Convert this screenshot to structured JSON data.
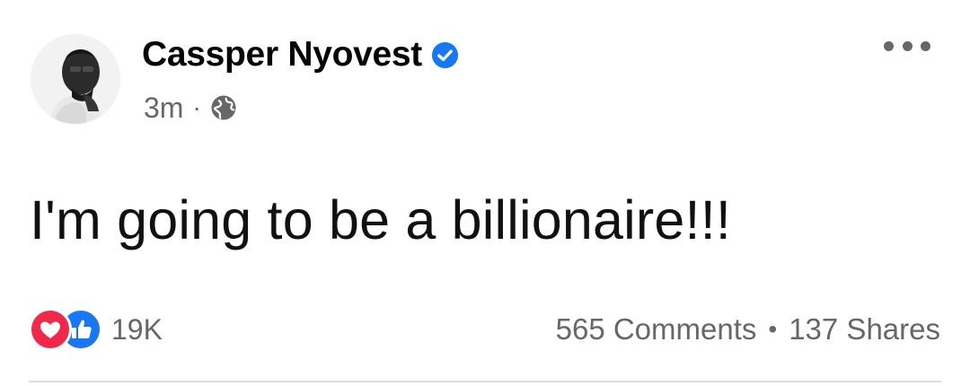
{
  "post": {
    "author": "Cassper Nyovest",
    "timestamp": "3m",
    "separator": "·",
    "audience_icon": "globe-icon",
    "verified_icon": "verified-badge-icon",
    "text": "I'm going to be a billionaire!!!"
  },
  "engagement": {
    "reaction_icons": [
      "love-reaction-icon",
      "like-reaction-icon"
    ],
    "reaction_count": "19K",
    "comments": "565 Comments",
    "separator": "•",
    "shares": "137 Shares"
  },
  "colors": {
    "verified_blue": "#1877f2",
    "love_red": "#f02849",
    "like_blue": "#1877f2",
    "meta_gray": "#65676b"
  }
}
